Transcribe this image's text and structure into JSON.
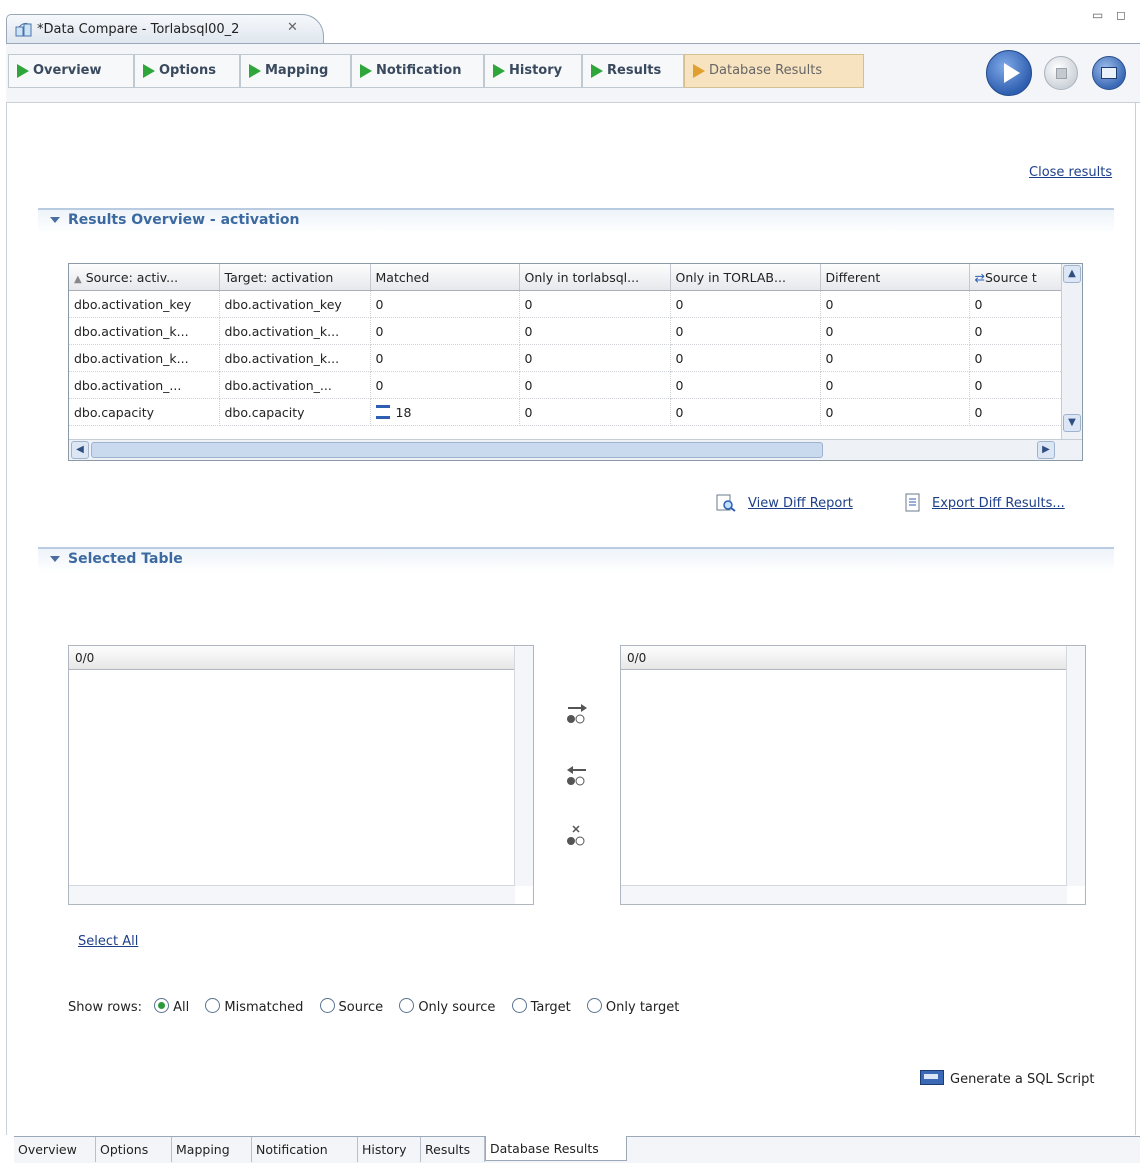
{
  "editor": {
    "title": "*Data Compare - Torlabsql00_2"
  },
  "page_tabs": [
    {
      "label": "Overview"
    },
    {
      "label": "Options"
    },
    {
      "label": "Mapping"
    },
    {
      "label": "Notification"
    },
    {
      "label": "History"
    },
    {
      "label": "Results"
    },
    {
      "label": "Database Results"
    }
  ],
  "close_results": "Close results",
  "results_overview": {
    "title": "Results Overview - activation",
    "columns": [
      "Source: activ...",
      "Target: activation",
      "Matched",
      "Only in torlabsql...",
      "Only in TORLAB...",
      "Different",
      "Source t"
    ],
    "rows": [
      [
        "dbo.activation_key",
        "dbo.activation_key",
        "0",
        "0",
        "0",
        "0",
        "0"
      ],
      [
        "dbo.activation_k...",
        "dbo.activation_k...",
        "0",
        "0",
        "0",
        "0",
        "0"
      ],
      [
        "dbo.activation_k...",
        "dbo.activation_k...",
        "0",
        "0",
        "0",
        "0",
        "0"
      ],
      [
        "dbo.activation_...",
        "dbo.activation_...",
        "0",
        "0",
        "0",
        "0",
        "0"
      ],
      [
        "dbo.capacity",
        "dbo.capacity",
        "18",
        "0",
        "0",
        "0",
        "0"
      ]
    ]
  },
  "view_diff_report": "View Diff Report",
  "export_diff_results": "Export Diff Results...",
  "selected_table": {
    "title": "Selected Table",
    "left_header": "0/0",
    "right_header": "0/0"
  },
  "select_all": "Select All",
  "show_rows": {
    "label": "Show rows:",
    "options": [
      "All",
      "Mismatched",
      "Source",
      "Only source",
      "Target",
      "Only target"
    ],
    "selected": "All"
  },
  "generate_sql": "Generate a SQL Script",
  "bottom_tabs": [
    "Overview",
    "Options",
    "Mapping",
    "Notification",
    "History",
    "Results",
    "Database Results"
  ],
  "colors": {
    "accent": "#3c6aa0",
    "run": "#2f5fb0",
    "green": "#2fa63a"
  }
}
